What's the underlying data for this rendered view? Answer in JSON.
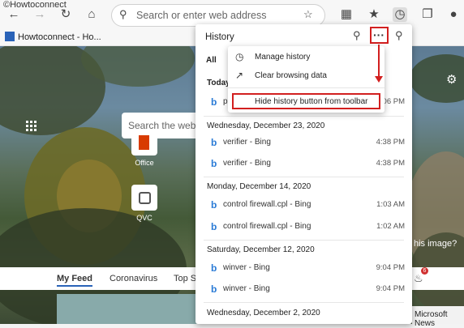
{
  "watermark": "©Howtoconnect",
  "toolbar": {
    "address_placeholder": "Search or enter web address"
  },
  "favorites": {
    "items": [
      {
        "label": "Howtoconnect - Ho..."
      }
    ]
  },
  "new_tab": {
    "search_placeholder": "Search the web",
    "tiles": [
      {
        "label": "Office"
      },
      {
        "label": "QVC"
      }
    ],
    "feed_tabs": [
      "My Feed",
      "Coronavirus",
      "Top S"
    ],
    "image_question": "his image?",
    "notification_count": "6",
    "ms_news": "Microsoft News"
  },
  "history_panel": {
    "title": "History",
    "tab_all": "All",
    "today_label": "Today",
    "today_item_prefix": "p",
    "today_item_time": "06 PM",
    "groups": [
      {
        "date": "Wednesday, December 23, 2020",
        "items": [
          {
            "title": "verifier - Bing",
            "time": "4:38 PM"
          },
          {
            "title": "verifier - Bing",
            "time": "4:38 PM"
          }
        ]
      },
      {
        "date": "Monday, December 14, 2020",
        "items": [
          {
            "title": "control firewall.cpl - Bing",
            "time": "1:03 AM"
          },
          {
            "title": "control firewall.cpl - Bing",
            "time": "1:02 AM"
          }
        ]
      },
      {
        "date": "Saturday, December 12, 2020",
        "items": [
          {
            "title": "winver - Bing",
            "time": "9:04 PM"
          },
          {
            "title": "winver - Bing",
            "time": "9:04 PM"
          }
        ]
      },
      {
        "date": "Wednesday, December 2, 2020",
        "items": []
      }
    ]
  },
  "more_menu": {
    "items": [
      {
        "label": "Manage history",
        "icon": "clock-icon"
      },
      {
        "label": "Clear browsing data",
        "icon": "external-link-icon"
      },
      {
        "label": "Hide history button from toolbar",
        "icon": "none"
      }
    ]
  },
  "colors": {
    "highlight": "#d21f1f",
    "bing": "#2a7bd6"
  }
}
